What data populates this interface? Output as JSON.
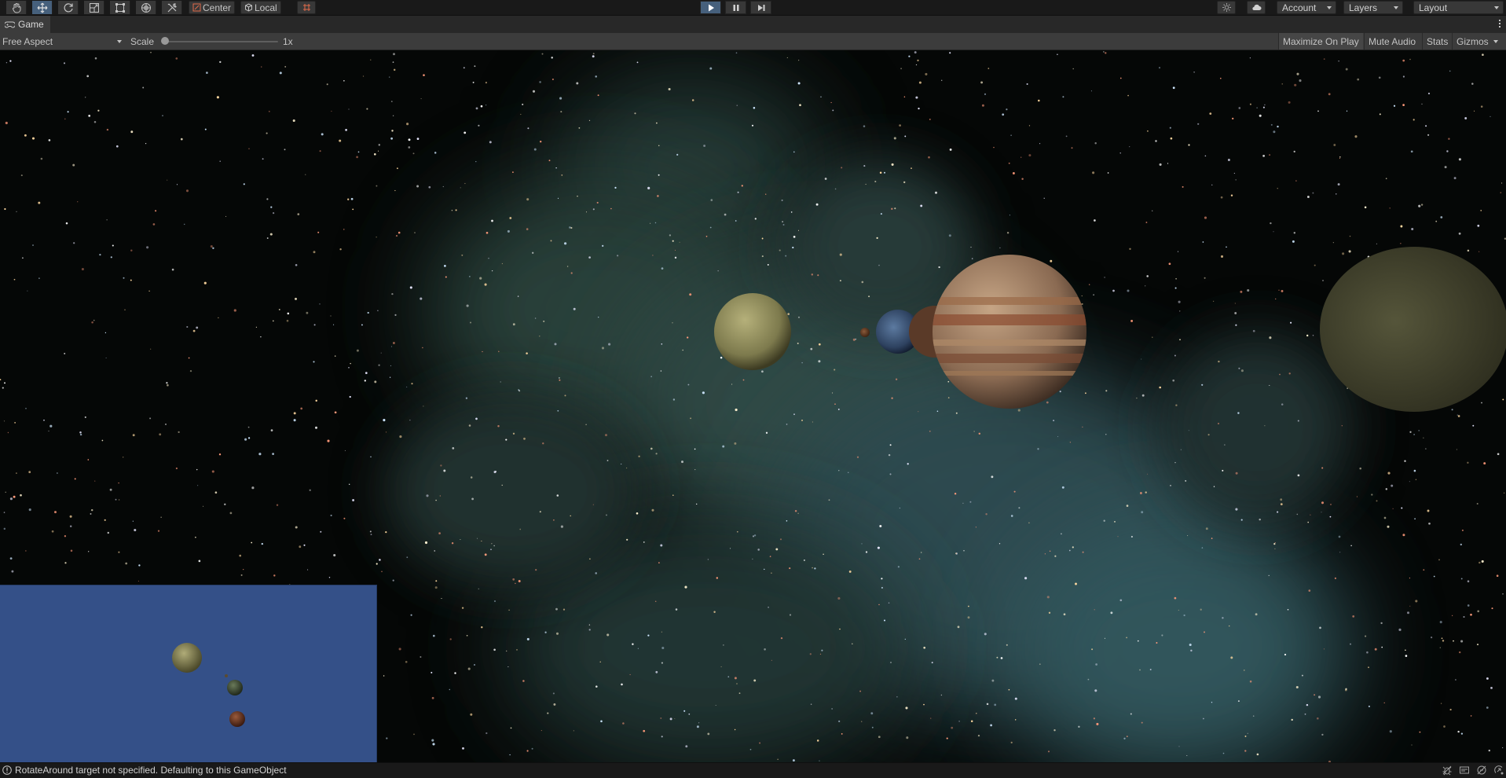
{
  "toolbar": {
    "tools": [
      {
        "icon": "hand-icon"
      },
      {
        "icon": "move-icon",
        "active": true
      },
      {
        "icon": "rotate-icon"
      },
      {
        "icon": "scale-icon"
      },
      {
        "icon": "rect-tool-icon"
      },
      {
        "icon": "transform-icon"
      },
      {
        "icon": "custom-tools-icon"
      }
    ],
    "pivot_mode": "Center",
    "pivot_rotation": "Local",
    "snap_icon": "grid-snap-icon",
    "play_controls": [
      {
        "icon": "play-icon",
        "active": true
      },
      {
        "icon": "pause-icon"
      },
      {
        "icon": "step-icon"
      }
    ],
    "right_icons": [
      "lighting-icon",
      "cloud-icon"
    ],
    "account_label": "Account",
    "layers_label": "Layers",
    "layout_label": "Layout"
  },
  "game_tab": {
    "title": "Game",
    "icon": "gamepad-icon"
  },
  "game_toolbar": {
    "aspect": "Free Aspect",
    "scale_label": "Scale",
    "scale_value": "1x",
    "scale_fraction": 0.0,
    "maximize_label": "Maximize On Play",
    "mute_label": "Mute Audio",
    "stats_label": "Stats",
    "gizmos_label": "Gizmos"
  },
  "status": {
    "icon": "info-icon",
    "message": "RotateAround target not specified. Defaulting to this GameObject",
    "right_icons": [
      "debug-icon",
      "progress-icon",
      "cache-icon",
      "auto-generate-icon"
    ]
  },
  "colors": {
    "accent": "#46607c",
    "minimap_bg": "#345088",
    "toolbar_bg": "#191919",
    "panel_bg": "#3c3c3c"
  }
}
